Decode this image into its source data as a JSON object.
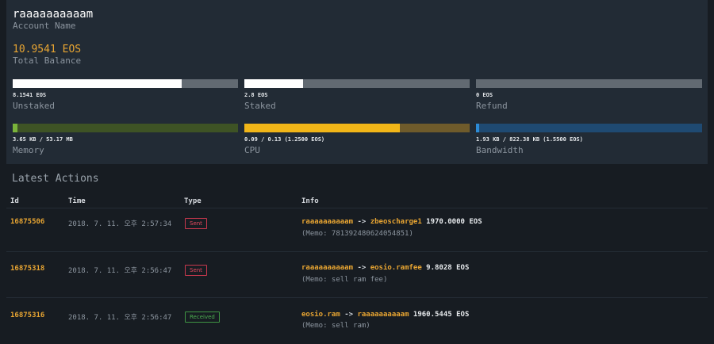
{
  "account": {
    "name": "raaaaaaaaaam",
    "name_label": "Account Name",
    "balance": "10.9541 EOS",
    "balance_label": "Total Balance"
  },
  "resources": [
    {
      "key": "unstaked",
      "value_text": "8.1541 EOS",
      "label": "Unstaked",
      "fill_fraction": 0.75,
      "fill_color": "#ffffff",
      "track_color": "#626a72"
    },
    {
      "key": "staked",
      "value_text": "2.8 EOS",
      "label": "Staked",
      "fill_fraction": 0.26,
      "fill_color": "#ffffff",
      "track_color": "#626a72"
    },
    {
      "key": "refund",
      "value_text": "0 EOS",
      "label": "Refund",
      "fill_fraction": 0.0,
      "fill_color": "#ffffff",
      "track_color": "#626a72"
    },
    {
      "key": "memory",
      "value_text": "3.65 KB / 53.17 MB",
      "label": "Memory",
      "fill_fraction": 0.02,
      "fill_color": "#7ab33b",
      "track_color": "#3e5325"
    },
    {
      "key": "cpu",
      "value_text": "0.09 / 0.13 (1.2500 EOS)",
      "label": "CPU",
      "fill_fraction": 0.69,
      "fill_color": "#f2b618",
      "track_color": "#6f5b2b"
    },
    {
      "key": "bandwidth",
      "value_text": "1.93 KB / 822.38 KB (1.5500 EOS)",
      "label": "Bandwidth",
      "fill_fraction": 0.01,
      "fill_color": "#2c8bd6",
      "track_color": "#1f4a72"
    }
  ],
  "actions": {
    "title": "Latest Actions",
    "columns": [
      "Id",
      "Time",
      "Type",
      "Info"
    ],
    "rows": [
      {
        "id": "16875506",
        "time": "2018. 7. 11. 오후 2:57:34",
        "type": "Sent",
        "type_kind": "sent",
        "from": "raaaaaaaaaam",
        "arrow": "->",
        "to": "zbeoscharge1",
        "amount": "1970.0000 EOS",
        "memo": "(Memo: 781392480624054851)"
      },
      {
        "id": "16875318",
        "time": "2018. 7. 11. 오후 2:56:47",
        "type": "Sent",
        "type_kind": "sent",
        "from": "raaaaaaaaaam",
        "arrow": "->",
        "to": "eosio.ramfee",
        "amount": "9.8028 EOS",
        "memo": "(Memo: sell ram fee)"
      },
      {
        "id": "16875316",
        "time": "2018. 7. 11. 오후 2:56:47",
        "type": "Received",
        "type_kind": "recv",
        "from": "eosio.ram",
        "arrow": "->",
        "to": "raaaaaaaaaam",
        "amount": "1960.5445 EOS",
        "memo": "(Memo: sell ram)"
      }
    ]
  }
}
